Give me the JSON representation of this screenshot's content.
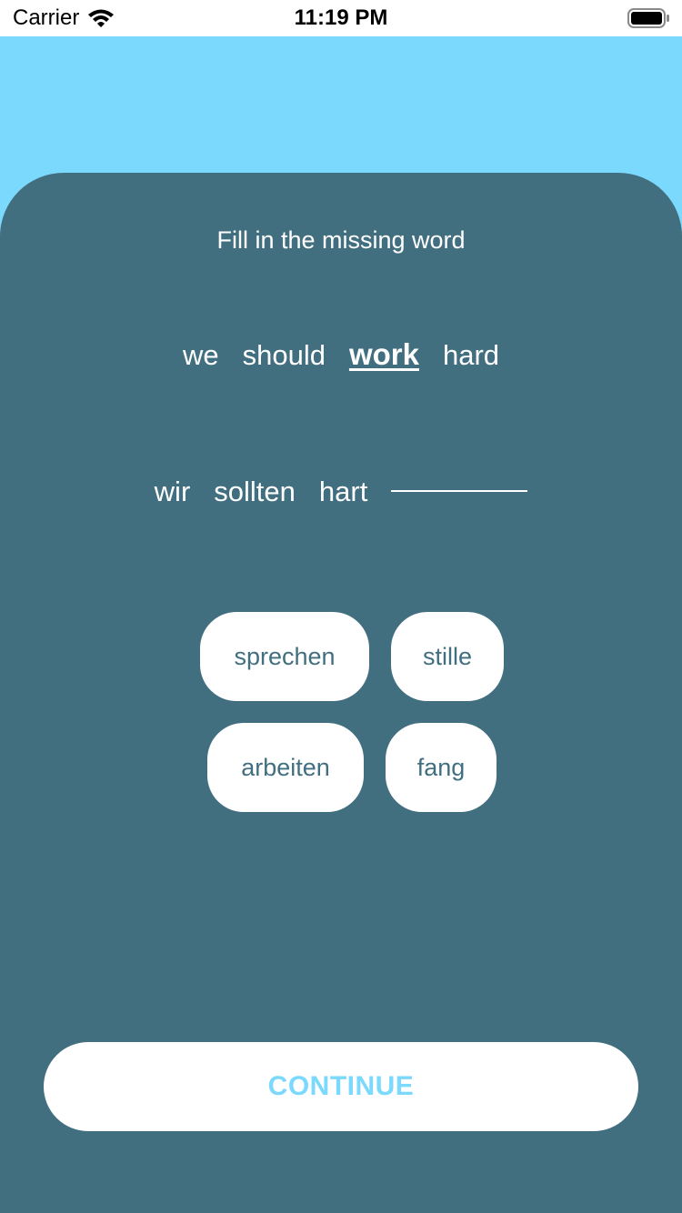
{
  "status_bar": {
    "carrier": "Carrier",
    "time": "11:19 PM"
  },
  "exercise": {
    "instruction": "Fill in the missing word",
    "source_words": [
      "we",
      "should",
      "work",
      "hard"
    ],
    "highlighted_word": "work",
    "target_words": [
      "wir",
      "sollten",
      "hart"
    ],
    "choices": [
      "sprechen",
      "stille",
      "arbeiten",
      "fang"
    ]
  },
  "continue_label": "CONTINUE",
  "colors": {
    "background": "#7ad9fd",
    "card": "#416f80",
    "choice_text": "#416f80",
    "continue_text": "#7ad9fd"
  }
}
